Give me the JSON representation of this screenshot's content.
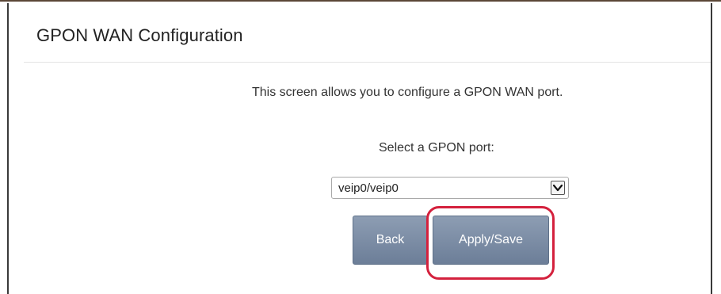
{
  "page": {
    "title": "GPON WAN Configuration",
    "description": "This screen allows you to configure a GPON WAN port.",
    "select_label": "Select a GPON port:"
  },
  "port_select": {
    "selected": "veip0/veip0",
    "arrow_icon": "chevron-down-icon"
  },
  "buttons": {
    "back": "Back",
    "apply_save": "Apply/Save"
  },
  "annotation": {
    "highlight_color": "#d4213d",
    "highlight_target": "apply-save-button"
  },
  "colors": {
    "button_bg": "#7a8ba4",
    "button_text": "#ffffff",
    "title_text": "#222222"
  }
}
